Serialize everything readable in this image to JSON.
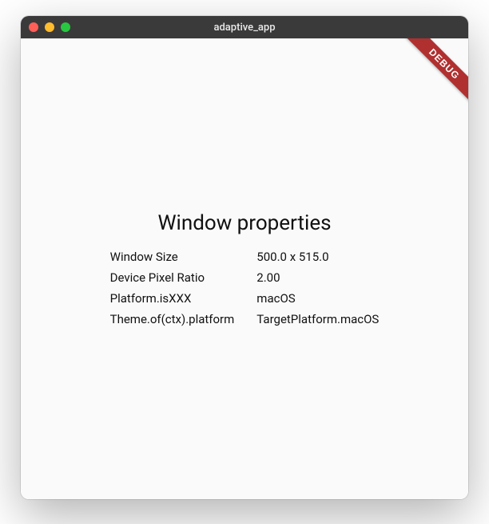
{
  "window": {
    "title": "adaptive_app"
  },
  "debug_ribbon": "DEBUG",
  "heading": "Window properties",
  "properties": [
    {
      "label": "Window Size",
      "value": "500.0 x 515.0"
    },
    {
      "label": "Device Pixel Ratio",
      "value": "2.00"
    },
    {
      "label": "Platform.isXXX",
      "value": "macOS"
    },
    {
      "label": "Theme.of(ctx).platform",
      "value": "TargetPlatform.macOS"
    }
  ]
}
